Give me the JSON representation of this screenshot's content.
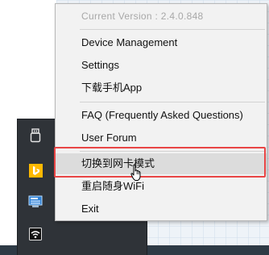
{
  "menu": {
    "version_label": "Current Version : 2.4.0.848",
    "items": [
      {
        "label": "Device Management"
      },
      {
        "label": "Settings"
      },
      {
        "label": "下载手机App"
      },
      {
        "label": "FAQ (Frequently Asked Questions)"
      },
      {
        "label": "User Forum"
      },
      {
        "label": "切换到网卡模式"
      },
      {
        "label": "重启随身WiFi"
      },
      {
        "label": "Exit"
      }
    ],
    "highlighted_item": "切换到网卡模式"
  },
  "tray": {
    "icons": [
      "usb-drive-icon",
      "bing-icon",
      "network-adapter-icon",
      "wifi-icon"
    ]
  },
  "colors": {
    "highlight_border": "#e84545",
    "menu_background": "#f2f2f2",
    "tray_background": "#2f3338"
  }
}
